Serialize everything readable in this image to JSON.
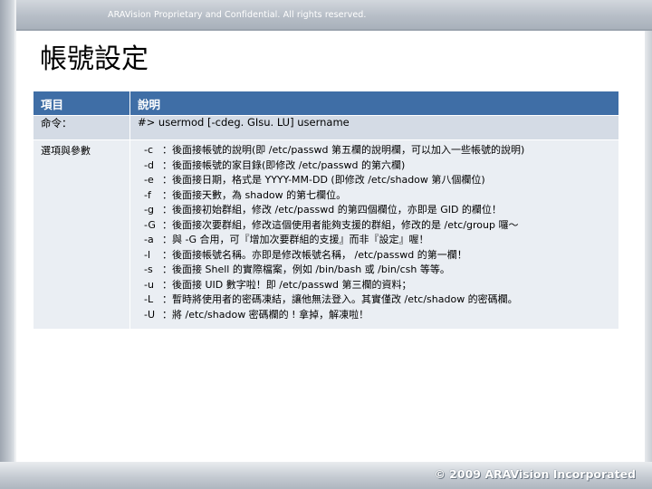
{
  "header": {
    "notice": "ARAVision Proprietary and Confidential. All rights reserved."
  },
  "slide": {
    "title": "帳號設定"
  },
  "table": {
    "headers": [
      "項目",
      "說明"
    ],
    "command": {
      "label": "命令：",
      "value": "#> usermod [-cdeg. GIsu. LU] username"
    },
    "options": {
      "label": "選項與參數",
      "lines": [
        {
          "flag": "-c",
          "text": "：後面接帳號的說明(即 /etc/passwd 第五欄的說明欄，可以加入一些帳號的說明)"
        },
        {
          "flag": "-d",
          "text": "：後面接帳號的家目錄(即修改 /etc/passwd 的第六欄)"
        },
        {
          "flag": "-e",
          "text": "：後面接日期，格式是 YYYY-MM-DD (即修改 /etc/shadow 第八個欄位)"
        },
        {
          "flag": "-f",
          "text": "：後面接天數，為 shadow 的第七欄位。"
        },
        {
          "flag": "-g",
          "text": "：後面接初始群組，修改 /etc/passwd 的第四個欄位，亦即是 GID 的欄位！"
        },
        {
          "flag": "-G",
          "text": "：後面接次要群組，修改這個使用者能夠支援的群組，修改的是 /etc/group 囉～"
        },
        {
          "flag": "-a",
          "text": "：與 -G 合用，可『增加次要群組的支援』而非『設定』喔！"
        },
        {
          "flag": "-l",
          "text": "：後面接帳號名稱。亦即是修改帳號名稱， /etc/passwd 的第一欄！"
        },
        {
          "flag": "-s",
          "text": "：後面接 Shell 的實際檔案，例如 /bin/bash 或 /bin/csh 等等。"
        },
        {
          "flag": "-u",
          "text": "：後面接 UID 數字啦！即 /etc/passwd 第三欄的資料；"
        },
        {
          "flag": "-L",
          "text": "：暫時將使用者的密碼凍結，讓他無法登入。其實僅改 /etc/shadow 的密碼欄。"
        },
        {
          "flag": "-U",
          "text": "：將 /etc/shadow 密碼欄的 ! 拿掉，解凍啦！"
        }
      ]
    }
  },
  "footer": {
    "copyright": "© 2009 ARAVision Incorporated"
  }
}
